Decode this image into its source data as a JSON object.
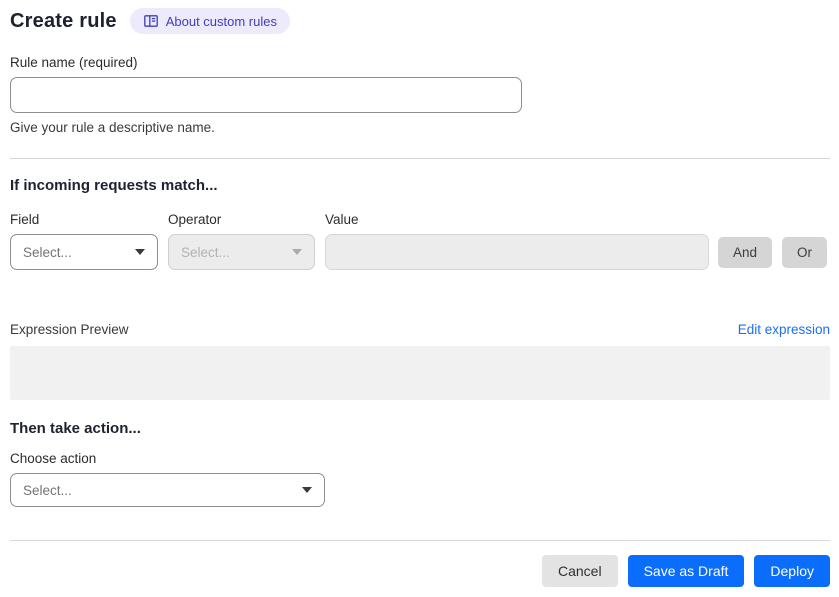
{
  "page": {
    "title": "Create rule",
    "about_link": {
      "label": "About custom rules",
      "icon": "book-icon"
    }
  },
  "rule_name": {
    "label": "Rule name (required)",
    "value": "",
    "helper": "Give your rule a descriptive name."
  },
  "match_section": {
    "heading": "If incoming requests match...",
    "field": {
      "label": "Field",
      "selected": "Select...",
      "disabled": false
    },
    "operator": {
      "label": "Operator",
      "selected": "Select...",
      "disabled": true
    },
    "value": {
      "label": "Value",
      "value": "",
      "disabled": true
    },
    "and_button": "And",
    "or_button": "Or"
  },
  "expression": {
    "label": "Expression Preview",
    "edit_link": "Edit expression",
    "preview_content": ""
  },
  "action_section": {
    "heading": "Then take action...",
    "choose_label": "Choose action",
    "selected": "Select..."
  },
  "footer": {
    "cancel": "Cancel",
    "save_draft": "Save as Draft",
    "deploy": "Deploy"
  },
  "colors": {
    "primary_button_blue": "#0b6dfb",
    "link_blue": "#1b6ef3",
    "badge_background": "#edeafc",
    "badge_text": "#3f3dbd",
    "disabled_control_background": "#ececec",
    "preview_box_background": "#f1f1f1",
    "divider": "#d8d8d8"
  }
}
